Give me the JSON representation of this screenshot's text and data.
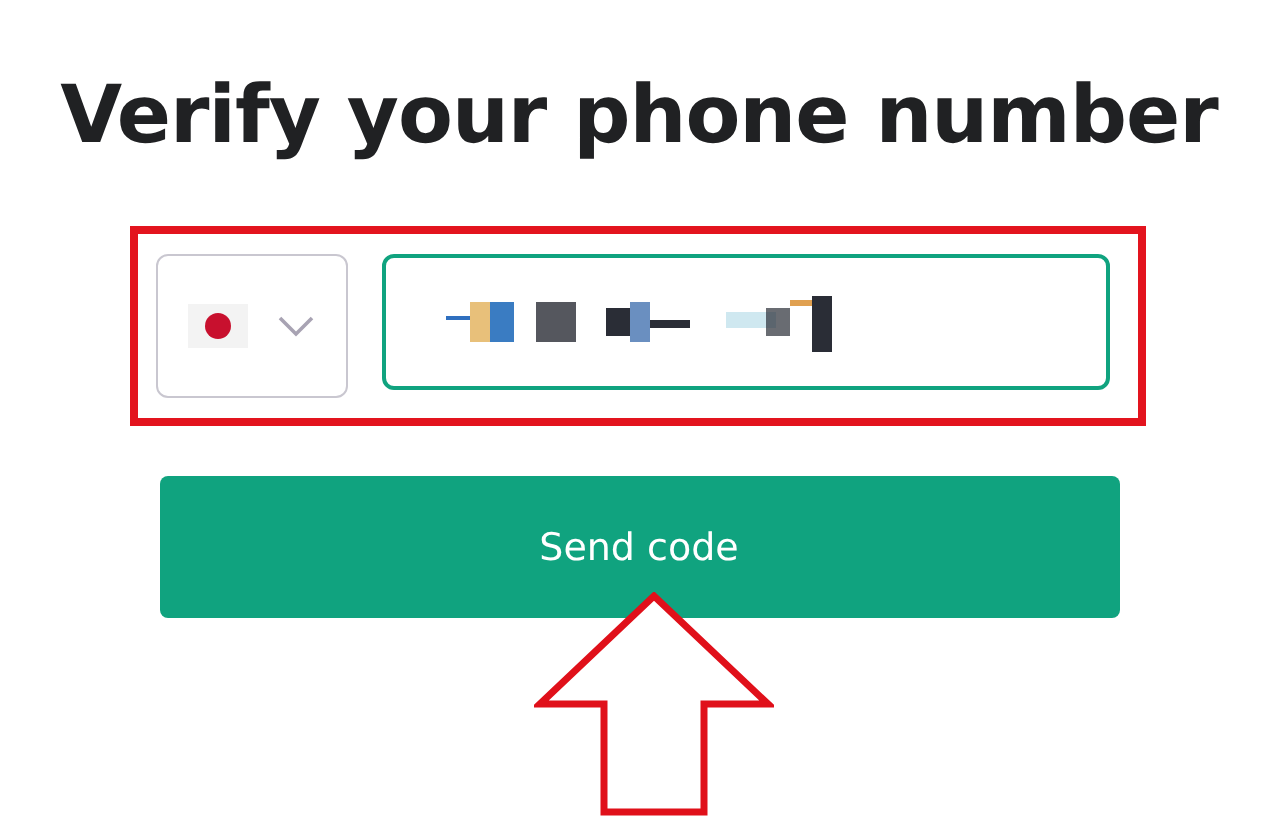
{
  "title": "Verify your phone number",
  "phone": {
    "focused": true
  },
  "send_button": {
    "label": "Send code"
  }
}
